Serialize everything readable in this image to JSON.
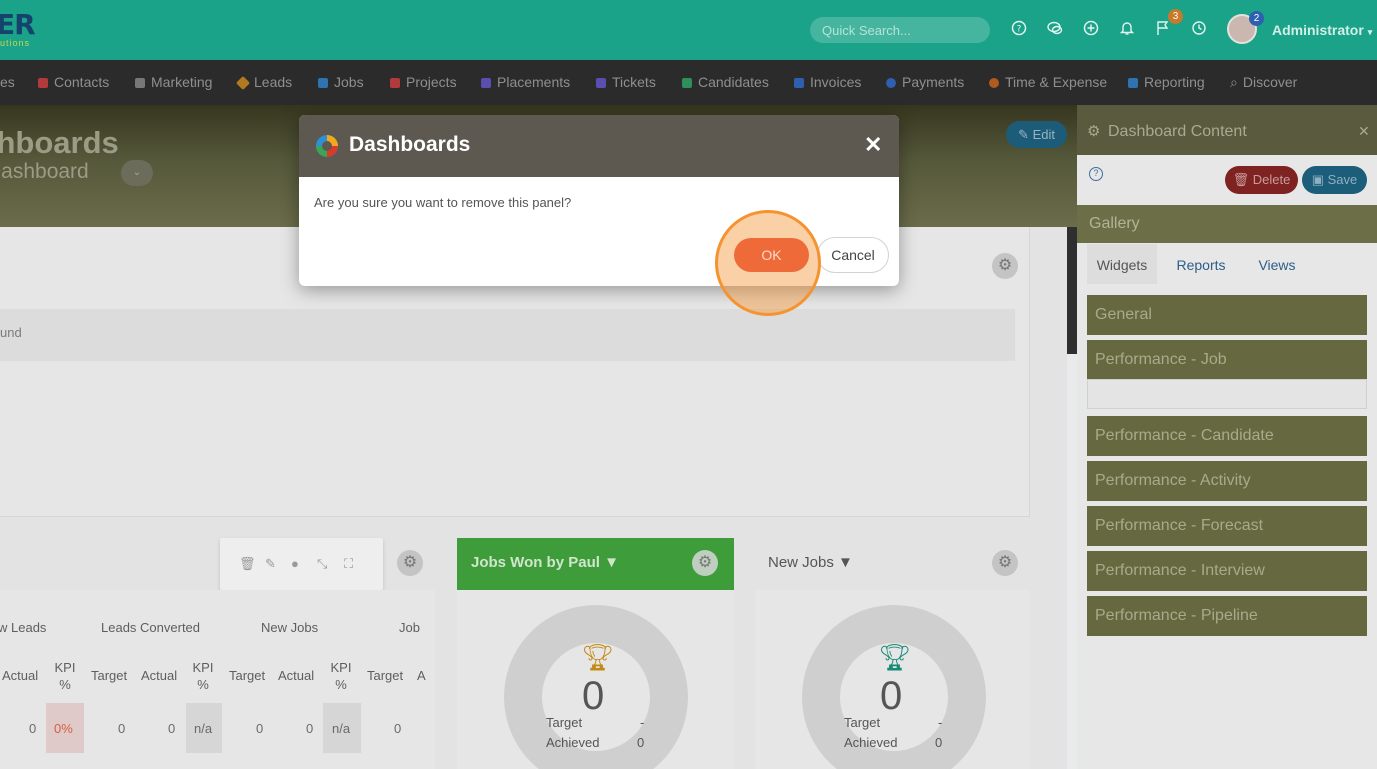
{
  "topbar": {
    "logo_text": "ER",
    "logo_sub": "utions",
    "search_placeholder": "Quick Search...",
    "flag_badge": "3",
    "avatar_badge": "2",
    "user_name": "Administrator"
  },
  "nav": {
    "items": [
      {
        "label": "es",
        "color": "#8f8f8f"
      },
      {
        "label": "Contacts",
        "color": "#b33a3a"
      },
      {
        "label": "Marketing",
        "color": "#8f8f8f"
      },
      {
        "label": "Leads",
        "color": "#b07a1e"
      },
      {
        "label": "Jobs",
        "color": "#2e74b0"
      },
      {
        "label": "Projects",
        "color": "#b33a3a"
      },
      {
        "label": "Placements",
        "color": "#5a4fb0"
      },
      {
        "label": "Tickets",
        "color": "#5a4fb0"
      },
      {
        "label": "Candidates",
        "color": "#2e8f5a"
      },
      {
        "label": "Invoices",
        "color": "#2e5fb0"
      },
      {
        "label": "Payments",
        "color": "#2e5fb0"
      },
      {
        "label": "Time & Expense",
        "color": "#b05a1e"
      },
      {
        "label": "Reporting",
        "color": "#2e74b0"
      },
      {
        "label": "Discover",
        "color": "#8f8f8f"
      }
    ]
  },
  "hero": {
    "title": "ashboards",
    "subtitle": "Dashboard",
    "edit_label": "Edit"
  },
  "main": {
    "not_found_text": "und",
    "toolbar_icons": [
      "trash-icon",
      "pencil-icon",
      "drop-icon",
      "collapse-icon",
      "expand-icon"
    ],
    "kpi_table": {
      "groups": [
        "w Leads",
        "Leads Converted",
        "New Jobs",
        "Job"
      ],
      "subheaders": [
        "Actual",
        "KPI %",
        "Target",
        "Actual",
        "KPI %",
        "Target",
        "Actual",
        "KPI %",
        "Target"
      ],
      "row": [
        "0",
        "0%",
        "0",
        "0",
        "n/a",
        "0",
        "0",
        "n/a",
        "0"
      ]
    },
    "jobs_won": {
      "title": "Jobs Won by Paul",
      "value": "0",
      "target_label": "Target",
      "target_value": "-",
      "achieved_label": "Achieved",
      "achieved_value": "0",
      "trophy_color": "#c48a14"
    },
    "new_jobs": {
      "title": "New Jobs",
      "value": "0",
      "target_label": "Target",
      "target_value": "-",
      "achieved_label": "Achieved",
      "achieved_value": "0",
      "trophy_color": "#1a8a78"
    }
  },
  "right_panel": {
    "title": "Dashboard Content",
    "delete_label": "Delete",
    "save_label": "Save",
    "gallery_label": "Gallery",
    "tabs": [
      "Widgets",
      "Reports",
      "Views"
    ],
    "sections": [
      "General",
      "Performance - Job",
      "Performance - Candidate",
      "Performance - Activity",
      "Performance - Forecast",
      "Performance - Interview",
      "Performance - Pipeline"
    ]
  },
  "modal": {
    "title": "Dashboards",
    "message": "Are you sure you want to remove this panel?",
    "ok_label": "OK",
    "cancel_label": "Cancel"
  }
}
